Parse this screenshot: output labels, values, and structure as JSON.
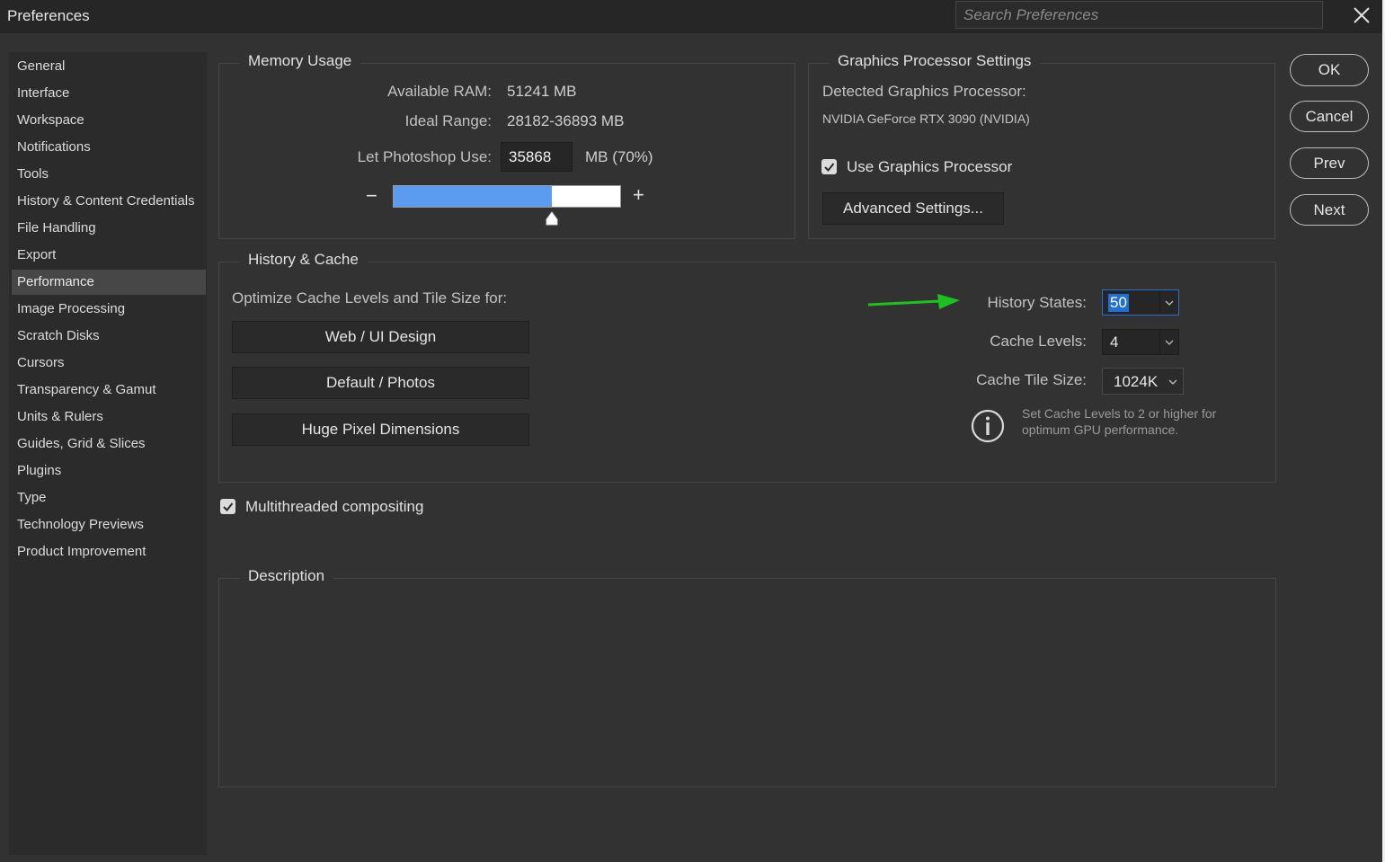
{
  "window": {
    "title": "Preferences",
    "search_placeholder": "Search Preferences"
  },
  "sidebar": {
    "items": [
      {
        "label": "General"
      },
      {
        "label": "Interface"
      },
      {
        "label": "Workspace"
      },
      {
        "label": "Notifications"
      },
      {
        "label": "Tools"
      },
      {
        "label": "History & Content Credentials"
      },
      {
        "label": "File Handling"
      },
      {
        "label": "Export"
      },
      {
        "label": "Performance",
        "active": true
      },
      {
        "label": "Image Processing"
      },
      {
        "label": "Scratch Disks"
      },
      {
        "label": "Cursors"
      },
      {
        "label": "Transparency & Gamut"
      },
      {
        "label": "Units & Rulers"
      },
      {
        "label": "Guides, Grid & Slices"
      },
      {
        "label": "Plugins"
      },
      {
        "label": "Type"
      },
      {
        "label": "Technology Previews"
      },
      {
        "label": "Product Improvement"
      }
    ]
  },
  "memory": {
    "legend": "Memory Usage",
    "available_label": "Available RAM:",
    "available_value": "51241 MB",
    "ideal_label": "Ideal Range:",
    "ideal_value": "28182-36893 MB",
    "use_label": "Let Photoshop Use:",
    "use_value": "35868",
    "use_unit": "MB (70%)",
    "slider_fraction": 0.7,
    "minus": "−",
    "plus": "+"
  },
  "gpu": {
    "legend": "Graphics Processor Settings",
    "detected_label": "Detected Graphics Processor:",
    "detected_value": "NVIDIA GeForce RTX 3090 (NVIDIA)",
    "use_gpu_label": "Use Graphics Processor",
    "use_gpu_checked": true,
    "advanced_button": "Advanced Settings..."
  },
  "history_cache": {
    "legend": "History & Cache",
    "optimize_label": "Optimize Cache Levels and Tile Size for:",
    "presets": [
      "Web / UI Design",
      "Default / Photos",
      "Huge Pixel Dimensions"
    ],
    "history_states_label": "History States:",
    "history_states_value": "50",
    "cache_levels_label": "Cache Levels:",
    "cache_levels_value": "4",
    "tile_size_label": "Cache Tile Size:",
    "tile_size_value": "1024K",
    "info_line1": "Set Cache Levels to 2 or higher for",
    "info_line2": "optimum GPU performance."
  },
  "multithread": {
    "label": "Multithreaded compositing",
    "checked": true
  },
  "description": {
    "legend": "Description"
  },
  "buttons": {
    "ok": "OK",
    "cancel": "Cancel",
    "prev": "Prev",
    "next": "Next"
  },
  "colors": {
    "accent": "#5b9cf0",
    "arrow": "#1ec21e",
    "highlight": "#1f6fd6"
  }
}
